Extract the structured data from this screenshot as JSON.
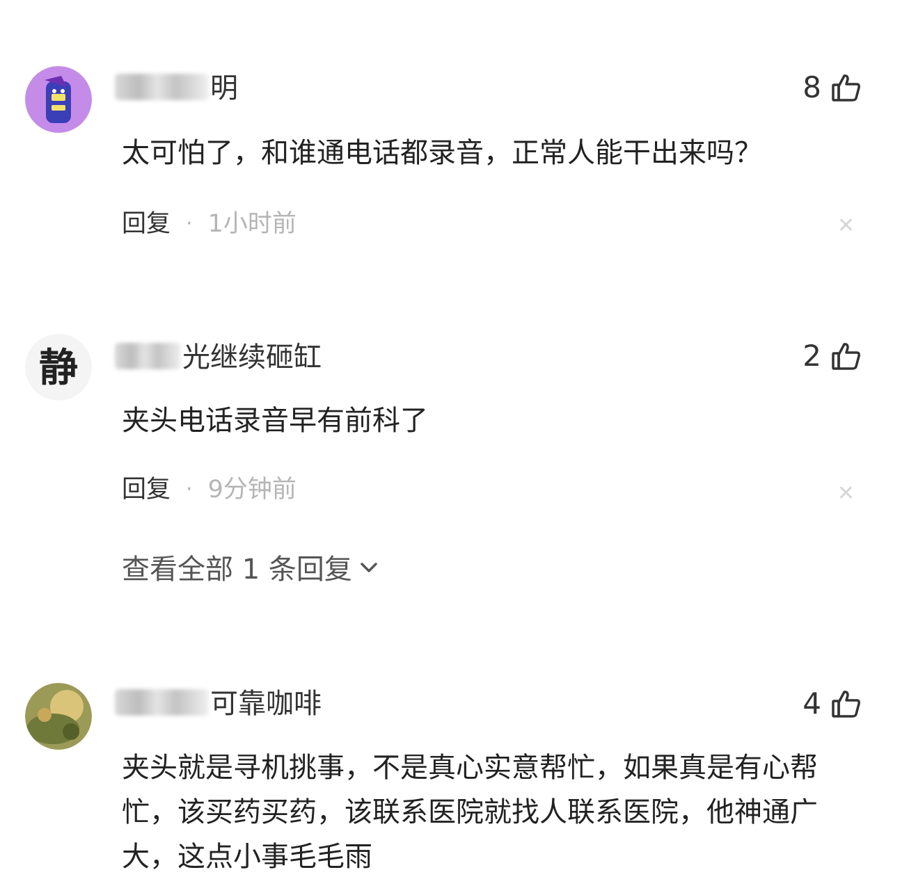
{
  "comments": [
    {
      "username_visible": "明",
      "likes": "8",
      "text": "太可怕了，和谁通电话都录音，正常人能干出来吗？",
      "reply_label": "回复",
      "separator": "·",
      "time": "1小时前",
      "avatar_text": ""
    },
    {
      "username_visible": "光继续砸缸",
      "likes": "2",
      "text": "夹头电话录音早有前科了",
      "reply_label": "回复",
      "separator": "·",
      "time": "9分钟前",
      "avatar_text": "静",
      "view_all_replies": "查看全部 1 条回复"
    },
    {
      "username_visible": "可靠咖啡",
      "likes": "4",
      "text": "夹头就是寻机挑事，不是真心实意帮忙，如果真是有心帮忙，该买药买药，该联系医院就找人联系医院，他神通广大，这点小事毛毛雨",
      "avatar_text": ""
    }
  ],
  "icons": {
    "like": "thumbs-up-icon",
    "close": "close-icon",
    "chevron": "chevron-down-icon"
  },
  "colors": {
    "text": "#222222",
    "muted": "#b5b5b5",
    "avatar1": "#b46fe0",
    "avatar3": "#8a8a3a"
  }
}
